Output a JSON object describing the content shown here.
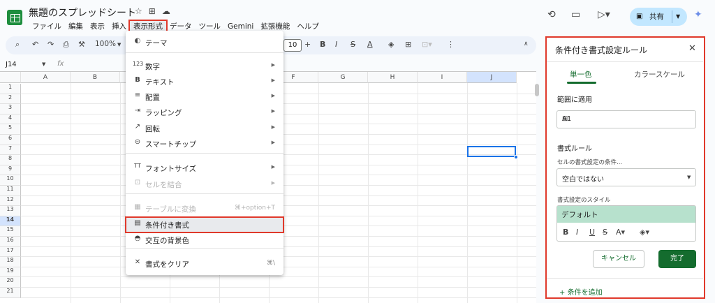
{
  "doc": {
    "title": "無題のスプレッドシート",
    "share_label": "共有"
  },
  "menubar": [
    "ファイル",
    "編集",
    "表示",
    "挿入",
    "表示形式",
    "データ",
    "ツール",
    "Gemini",
    "拡張機能",
    "ヘルプ"
  ],
  "toolbar": {
    "zoom": "100%",
    "font_size": "10"
  },
  "formula": {
    "name_box": "J14",
    "fx": "fx"
  },
  "grid": {
    "columns": [
      "A",
      "B",
      "C",
      "D",
      "E",
      "F",
      "G",
      "H",
      "I",
      "J"
    ],
    "rows": [
      "1",
      "2",
      "3",
      "4",
      "5",
      "6",
      "7",
      "8",
      "9",
      "10",
      "11",
      "12",
      "13",
      "14",
      "15",
      "16",
      "17",
      "18",
      "19",
      "20",
      "21"
    ],
    "selected_col": "J",
    "selected_row": "14"
  },
  "format_menu": {
    "items": [
      {
        "icon": "palette-icon",
        "glyph": "◐",
        "label": "テーマ",
        "arrow": false,
        "disabled": false
      },
      {
        "icon": "number-icon",
        "glyph": "123",
        "label": "数字",
        "arrow": true,
        "disabled": false
      },
      {
        "icon": "bold-icon",
        "glyph": "B",
        "label": "テキスト",
        "arrow": true,
        "disabled": false
      },
      {
        "icon": "align-icon",
        "glyph": "≡",
        "label": "配置",
        "arrow": true,
        "disabled": false
      },
      {
        "icon": "wrap-icon",
        "glyph": "⇥",
        "label": "ラッピング",
        "arrow": true,
        "disabled": false
      },
      {
        "icon": "rotate-icon",
        "glyph": "↗",
        "label": "回転",
        "arrow": true,
        "disabled": false
      },
      {
        "icon": "smart-chip-icon",
        "glyph": "⊝",
        "label": "スマートチップ",
        "arrow": true,
        "disabled": false
      },
      {
        "icon": "font-size-icon",
        "glyph": "TT",
        "label": "フォントサイズ",
        "arrow": true,
        "disabled": false
      },
      {
        "icon": "merge-icon",
        "glyph": "⊡",
        "label": "セルを結合",
        "arrow": true,
        "disabled": true
      },
      {
        "icon": "table-icon",
        "glyph": "▦",
        "label": "テーブルに変換",
        "shortcut": "⌘+option+T",
        "arrow": false,
        "disabled": true
      },
      {
        "icon": "paint-roller-icon",
        "glyph": "▤",
        "label": "条件付き書式",
        "arrow": false,
        "disabled": false
      },
      {
        "icon": "fill-drop-icon",
        "glyph": "◓",
        "label": "交互の背景色",
        "arrow": false,
        "disabled": false
      },
      {
        "icon": "clear-format-icon",
        "glyph": "✕",
        "label": "書式をクリア",
        "shortcut": "⌘\\",
        "arrow": false,
        "disabled": false
      }
    ]
  },
  "panel": {
    "title": "条件付き書式設定ルール",
    "tab_single": "単一色",
    "tab_scale": "カラースケール",
    "range_label": "範囲に適用",
    "range_value": "A1",
    "rules_label": "書式ルール",
    "condition_label": "セルの書式設定の条件...",
    "condition_value": "空白ではない",
    "style_label": "書式設定のスタイル",
    "style_preview": "デフォルト",
    "cancel": "キャンセル",
    "done": "完了",
    "add_rule": "条件を追加"
  }
}
